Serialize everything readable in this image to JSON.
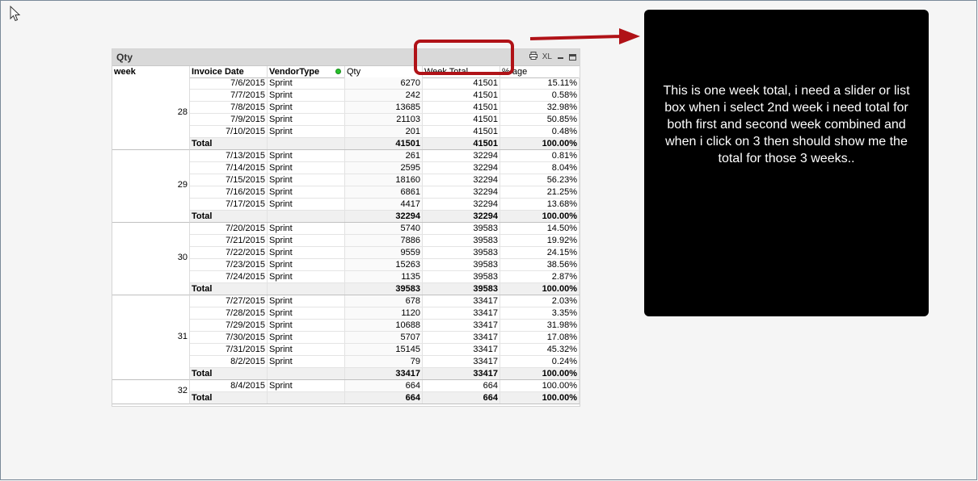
{
  "table": {
    "title": "Qty",
    "icons": [
      "print-icon",
      "xl-export-icon",
      "minimize-icon",
      "maximize-icon"
    ],
    "xl_label": "XL",
    "headers": {
      "week": "week",
      "invoice_date": "Invoice Date",
      "vendor_type": "VendorType",
      "qty": "Qty",
      "week_total": "Week Total",
      "pct": "% age"
    },
    "weeks": [
      {
        "week": "28",
        "rows": [
          {
            "date": "7/6/2015",
            "vendor": "Sprint",
            "qty": "6270",
            "week_total": "41501",
            "pct": "15.11%"
          },
          {
            "date": "7/7/2015",
            "vendor": "Sprint",
            "qty": "242",
            "week_total": "41501",
            "pct": "0.58%"
          },
          {
            "date": "7/8/2015",
            "vendor": "Sprint",
            "qty": "13685",
            "week_total": "41501",
            "pct": "32.98%"
          },
          {
            "date": "7/9/2015",
            "vendor": "Sprint",
            "qty": "21103",
            "week_total": "41501",
            "pct": "50.85%"
          },
          {
            "date": "7/10/2015",
            "vendor": "Sprint",
            "qty": "201",
            "week_total": "41501",
            "pct": "0.48%"
          }
        ],
        "total": {
          "label": "Total",
          "qty": "41501",
          "week_total": "41501",
          "pct": "100.00%"
        }
      },
      {
        "week": "29",
        "rows": [
          {
            "date": "7/13/2015",
            "vendor": "Sprint",
            "qty": "261",
            "week_total": "32294",
            "pct": "0.81%"
          },
          {
            "date": "7/14/2015",
            "vendor": "Sprint",
            "qty": "2595",
            "week_total": "32294",
            "pct": "8.04%"
          },
          {
            "date": "7/15/2015",
            "vendor": "Sprint",
            "qty": "18160",
            "week_total": "32294",
            "pct": "56.23%"
          },
          {
            "date": "7/16/2015",
            "vendor": "Sprint",
            "qty": "6861",
            "week_total": "32294",
            "pct": "21.25%"
          },
          {
            "date": "7/17/2015",
            "vendor": "Sprint",
            "qty": "4417",
            "week_total": "32294",
            "pct": "13.68%"
          }
        ],
        "total": {
          "label": "Total",
          "qty": "32294",
          "week_total": "32294",
          "pct": "100.00%"
        }
      },
      {
        "week": "30",
        "rows": [
          {
            "date": "7/20/2015",
            "vendor": "Sprint",
            "qty": "5740",
            "week_total": "39583",
            "pct": "14.50%"
          },
          {
            "date": "7/21/2015",
            "vendor": "Sprint",
            "qty": "7886",
            "week_total": "39583",
            "pct": "19.92%"
          },
          {
            "date": "7/22/2015",
            "vendor": "Sprint",
            "qty": "9559",
            "week_total": "39583",
            "pct": "24.15%"
          },
          {
            "date": "7/23/2015",
            "vendor": "Sprint",
            "qty": "15263",
            "week_total": "39583",
            "pct": "38.56%"
          },
          {
            "date": "7/24/2015",
            "vendor": "Sprint",
            "qty": "1135",
            "week_total": "39583",
            "pct": "2.87%"
          }
        ],
        "total": {
          "label": "Total",
          "qty": "39583",
          "week_total": "39583",
          "pct": "100.00%"
        }
      },
      {
        "week": "31",
        "rows": [
          {
            "date": "7/27/2015",
            "vendor": "Sprint",
            "qty": "678",
            "week_total": "33417",
            "pct": "2.03%"
          },
          {
            "date": "7/28/2015",
            "vendor": "Sprint",
            "qty": "1120",
            "week_total": "33417",
            "pct": "3.35%"
          },
          {
            "date": "7/29/2015",
            "vendor": "Sprint",
            "qty": "10688",
            "week_total": "33417",
            "pct": "31.98%"
          },
          {
            "date": "7/30/2015",
            "vendor": "Sprint",
            "qty": "5707",
            "week_total": "33417",
            "pct": "17.08%"
          },
          {
            "date": "7/31/2015",
            "vendor": "Sprint",
            "qty": "15145",
            "week_total": "33417",
            "pct": "45.32%"
          },
          {
            "date": "8/2/2015",
            "vendor": "Sprint",
            "qty": "79",
            "week_total": "33417",
            "pct": "0.24%"
          }
        ],
        "total": {
          "label": "Total",
          "qty": "33417",
          "week_total": "33417",
          "pct": "100.00%"
        }
      },
      {
        "week": "32",
        "rows": [
          {
            "date": "8/4/2015",
            "vendor": "Sprint",
            "qty": "664",
            "week_total": "664",
            "pct": "100.00%"
          }
        ],
        "total": {
          "label": "Total",
          "qty": "664",
          "week_total": "664",
          "pct": "100.00%"
        }
      }
    ]
  },
  "annotation": {
    "text": "This is one week total, i need a slider or list box when i select 2nd week i need total for both first and second week combined and when i click on 3 then should show me the total for those 3 weeks..",
    "highlight_color": "#b01217",
    "box_color": "#000000"
  }
}
